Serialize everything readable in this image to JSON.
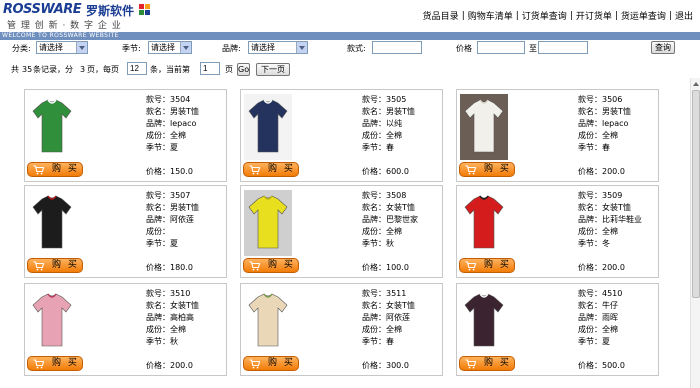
{
  "header": {
    "logo_en": "ROSSWARE",
    "logo_cn": "罗斯软件",
    "tagline": "管 理 创 新 · 数 字 企 业",
    "band_text": "WELCOME TO ROSSWARE WEBSITE",
    "nav": [
      "货品目录",
      "购物车清单",
      "订货单查询",
      "开订货单",
      "货运单查询",
      "退出"
    ],
    "logo_colors": [
      "#e3232b",
      "#f7a21a",
      "#2e8b3a",
      "#1b3e94"
    ]
  },
  "filters": {
    "category_label": "分类:",
    "category_value": "请选择",
    "season_label": "季节:",
    "season_value": "请选择",
    "brand_label": "品牌:",
    "brand_value": "请选择",
    "style_label": "款式:",
    "price_label": "价格",
    "price_to": "至",
    "search_button": "查询"
  },
  "pager": {
    "t1": "共",
    "total": "35",
    "t2": "条记录，分",
    "pages": "3",
    "t3": "页，每页",
    "per_page": "12",
    "t4": "条，当前第",
    "current": "1",
    "t5": "页",
    "go": "Go",
    "next": "下一页"
  },
  "labels": {
    "code": "款号：",
    "name": "款名：",
    "brand": "品牌：",
    "material": "成份：",
    "season": "季节：",
    "price": "价格：",
    "buy": "购 买"
  },
  "products": [
    {
      "code": "3504",
      "name": "男装T恤",
      "brand": "lepaco",
      "material": "全棉",
      "season": "夏",
      "price": "150.0",
      "image": "shirt-icon"
    },
    {
      "code": "3505",
      "name": "男装T恤",
      "brand": "以纯",
      "material": "全棉",
      "season": "春",
      "price": "600.0",
      "image": "shirt-icon"
    },
    {
      "code": "3506",
      "name": "男装T恤",
      "brand": "lepaco",
      "material": "全棉",
      "season": "春",
      "price": "200.0",
      "image": "shirt-icon"
    },
    {
      "code": "3507",
      "name": "男装T恤",
      "brand": "阿依莲",
      "material": "",
      "season": "夏",
      "price": "180.0",
      "image": "shirt-icon"
    },
    {
      "code": "3508",
      "name": "女装T恤",
      "brand": "巴黎世家",
      "material": "全棉",
      "season": "秋",
      "price": "100.0",
      "image": "shirt-icon"
    },
    {
      "code": "3509",
      "name": "女装T恤",
      "brand": "比莉华鞋业",
      "material": "全棉",
      "season": "冬",
      "price": "200.0",
      "image": "shirt-icon"
    },
    {
      "code": "3510",
      "name": "女装T恤",
      "brand": "高柏高",
      "material": "全棉",
      "season": "秋",
      "price": "200.0",
      "image": "shirt-icon"
    },
    {
      "code": "3511",
      "name": "女装T恤",
      "brand": "阿依莲",
      "material": "全棉",
      "season": "春",
      "price": "300.0",
      "image": "shirt-icon"
    },
    {
      "code": "4510",
      "name": "牛仔",
      "brand": "雨晖",
      "material": "全棉",
      "season": "夏",
      "price": "500.0",
      "image": "shirt-icon"
    }
  ]
}
